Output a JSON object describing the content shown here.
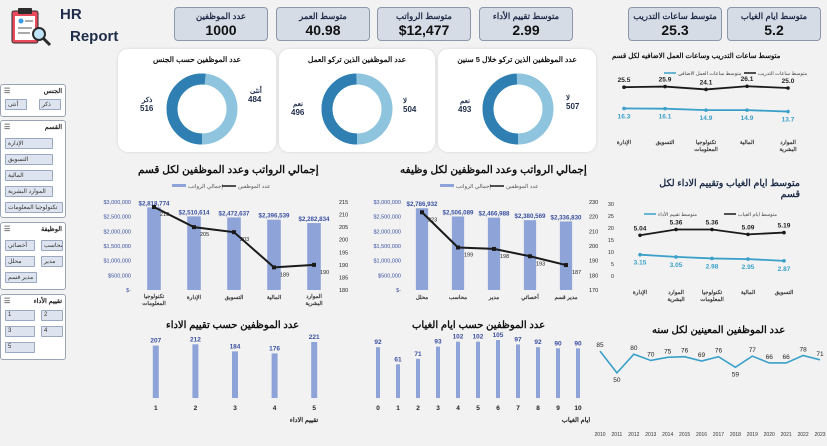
{
  "header": {
    "title": "HR",
    "subtitle": "Report"
  },
  "kpis": [
    {
      "title": "متوسط ايام الغياب",
      "value": "5.2"
    },
    {
      "title": "متوسط ساعات التدريب",
      "value": "25.3"
    },
    {
      "title": "متوسط تقييم الأداء",
      "value": "2.99"
    },
    {
      "title": "متوسط الرواتب",
      "value": "$12,477"
    },
    {
      "title": "متوسط العمر",
      "value": "40.98"
    },
    {
      "title": "عدد الموظفين",
      "value": "1000"
    }
  ],
  "slicers": {
    "gender": {
      "title": "الجنس",
      "items": [
        "ذكر",
        "أنثى"
      ]
    },
    "dept": {
      "title": "القسم",
      "items": [
        "الإدارة",
        "التسويق",
        "المالية",
        "الموارد البشرية",
        "تكنولوجيا المعلومات"
      ]
    },
    "job": {
      "title": "الوظيفة",
      "items": [
        "محاسب",
        "أخصائي",
        "مدير",
        "محلل",
        "مدير قسم"
      ]
    },
    "rating": {
      "title": "تقييم الأداء",
      "items": [
        "2",
        "1",
        "4",
        "3",
        "5"
      ]
    }
  },
  "colors": {
    "bar": "#8ea4d8",
    "line": "#1a1a1a",
    "teal": "#3aa0c9",
    "donut_dark": "#2f7fb2",
    "donut_light": "#8fc4de"
  },
  "donuts": [
    {
      "title": "عدد الموظفين الذين تركو خلال 5 سنين",
      "left_label": "نعم",
      "left_value": "493",
      "right_label": "لا",
      "right_value": "507",
      "left_share": 0.493
    },
    {
      "title": "عدد الموظفين الذين تركو العمل",
      "left_label": "نعم",
      "left_value": "496",
      "right_label": "لا",
      "right_value": "504",
      "left_share": 0.496
    },
    {
      "title": "عدد الموظفين حسب الجنس",
      "left_label": "ذكر",
      "left_value": "516",
      "right_label": "أنثى",
      "right_value": "484",
      "left_share": 0.516
    }
  ],
  "chart_data": [
    {
      "type": "bar",
      "id": "sal_dept",
      "title": "إجمالي الرواتب وعدد الموظفين لكل قسم",
      "legend": [
        "إجمالي الرواتب",
        "عدد الموظفين"
      ],
      "categories": [
        "تكنولوجيا المعلومات",
        "الإدارة",
        "التسويق",
        "المالية",
        "الموارد البشرية"
      ],
      "series": [
        {
          "name": "إجمالي الرواتب",
          "values": [
            2818774,
            2510614,
            2472637,
            2396539,
            2282834
          ],
          "labels": [
            "$2,818,774",
            "$2,510,614",
            "$2,472,637",
            "$2,396,539",
            "$2,282,834"
          ]
        },
        {
          "name": "عدد الموظفين",
          "values": [
            213,
            205,
            203,
            189,
            190
          ]
        }
      ],
      "y_ticks": [
        "$3,000,000",
        "$2,500,000",
        "$2,000,000",
        "$1,500,000",
        "$1,000,000",
        "$500,000",
        "$-"
      ],
      "y2_ticks": [
        "215",
        "210",
        "205",
        "200",
        "195",
        "190",
        "185",
        "180"
      ],
      "ylim": [
        0,
        3000000
      ],
      "y2lim": [
        180,
        215
      ]
    },
    {
      "type": "bar",
      "id": "sal_job",
      "title": "إجمالي الرواتب وعدد الموظفين لكل وظيفه",
      "legend": [
        "إجمالي الرواتب",
        "عدد الموظفين"
      ],
      "categories": [
        "محلل",
        "محاسب",
        "مدير",
        "أخصائي",
        "مدير قسم"
      ],
      "series": [
        {
          "name": "إجمالي الرواتب",
          "values": [
            2786932,
            2506089,
            2466988,
            2380569,
            2336830
          ],
          "labels": [
            "$2,786,932",
            "$2,506,089",
            "$2,466,988",
            "$2,380,569",
            "$2,336,830"
          ]
        },
        {
          "name": "عدد الموظفين",
          "values": [
            223,
            199,
            198,
            193,
            187
          ]
        }
      ],
      "y_ticks": [
        "$3,000,000",
        "$2,500,000",
        "$2,000,000",
        "$1,500,000",
        "$1,000,000",
        "$500,000",
        "$-"
      ],
      "y2_ticks": [
        "230",
        "220",
        "210",
        "200",
        "190",
        "180",
        "170"
      ],
      "ylim": [
        0,
        3000000
      ],
      "y2lim": [
        170,
        230
      ]
    },
    {
      "type": "line",
      "id": "train_dept",
      "title": "متوسط ساعات التدريب وساعات العمل الاضافيه لكل قسم",
      "legend": [
        "متوسط ساعات العمل الاضافي",
        "متوسط ساعات التدريب"
      ],
      "categories": [
        "الإدارة",
        "التسويق",
        "تكنولوجيا المعلومات",
        "المالية",
        "الموارد البشرية"
      ],
      "series": [
        {
          "name": "متوسط ساعات التدريب",
          "values": [
            25.5,
            25.9,
            24.1,
            26.1,
            25.0
          ]
        },
        {
          "name": "متوسط ساعات العمل الاضافي",
          "values": [
            16.3,
            16.1,
            14.9,
            14.9,
            13.7
          ]
        }
      ]
    },
    {
      "type": "line",
      "id": "abs_dept",
      "title": "متوسط ايام الغياب وتقييم الاداء لكل قسم",
      "legend": [
        "متوسط تقييم الأداء",
        "متوسط ايام الغياب"
      ],
      "categories": [
        "الإدارة",
        "الموارد البشرية",
        "تكنولوجيا المعلومات",
        "المالية",
        "التسويق"
      ],
      "series": [
        {
          "name": "متوسط ايام الغياب",
          "values": [
            5.04,
            5.36,
            5.36,
            5.09,
            5.19
          ]
        },
        {
          "name": "متوسط تقييم الأداء",
          "values": [
            3.15,
            3.05,
            2.98,
            2.95,
            2.87
          ]
        }
      ]
    },
    {
      "type": "bar",
      "id": "emp_rating",
      "title": "عدد الموظفين حسب تقييم الاداء",
      "xlabel": "تقييم الاداء",
      "categories": [
        "1",
        "2",
        "3",
        "4",
        "5"
      ],
      "values": [
        207,
        212,
        184,
        176,
        221
      ]
    },
    {
      "type": "bar",
      "id": "emp_abs",
      "title": "عدد الموظفين حسب ايام الغياب",
      "xlabel": "ايام الغياب",
      "categories": [
        "0",
        "1",
        "2",
        "3",
        "4",
        "5",
        "6",
        "7",
        "8",
        "9",
        "10"
      ],
      "values": [
        92,
        61,
        71,
        93,
        102,
        102,
        105,
        97,
        92,
        90,
        90
      ]
    },
    {
      "type": "line",
      "id": "hire_year",
      "title": "عدد الموظفين المعينين لكل سنه",
      "categories": [
        "2010",
        "2011",
        "2012",
        "2013",
        "2014",
        "2015",
        "2016",
        "2017",
        "2018",
        "2019",
        "2020",
        "2021",
        "2022",
        "2023"
      ],
      "values": [
        85,
        50,
        80,
        70,
        75,
        76,
        69,
        76,
        59,
        77,
        66,
        66,
        78,
        71
      ]
    }
  ]
}
